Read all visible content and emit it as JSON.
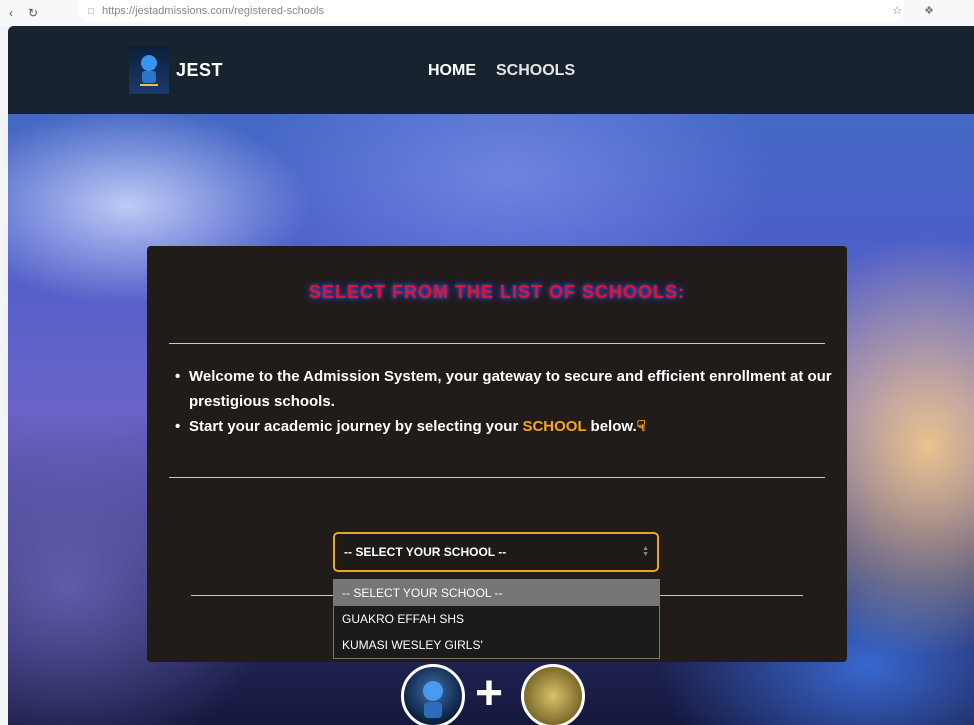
{
  "browser": {
    "url": "https://jestadmissions.com/registered-schools",
    "back_icon": "back-icon",
    "reload_icon": "reload-icon"
  },
  "header": {
    "brand": "JEST",
    "logo_icon": "robot-logo-icon",
    "nav": [
      {
        "label": "HOME"
      },
      {
        "label": "SCHOOLS"
      }
    ]
  },
  "card": {
    "title": "SELECT FROM THE LIST OF SCHOOLS:",
    "intro_1": "Welcome to the Admission System, your gateway to secure and efficient enrollment at our prestigious schools.",
    "intro_2_before": "Start your academic journey by selecting your",
    "intro_2_highlight": "SCHOOL",
    "intro_2_after": "below.",
    "pointer_icon": "pointing-down-icon"
  },
  "school_select": {
    "value": "-- SELECT YOUR SCHOOL --",
    "options": [
      {
        "label": "-- SELECT YOUR SCHOOL --"
      },
      {
        "label": "GUAKRO EFFAH SHS"
      },
      {
        "label": "KUMASI WESLEY GIRLS'"
      }
    ]
  },
  "colors": {
    "title_red": "#e0142b",
    "highlight_orange": "#f5a623",
    "nav_bg": "#17232f",
    "card_bg": "#211b19"
  }
}
